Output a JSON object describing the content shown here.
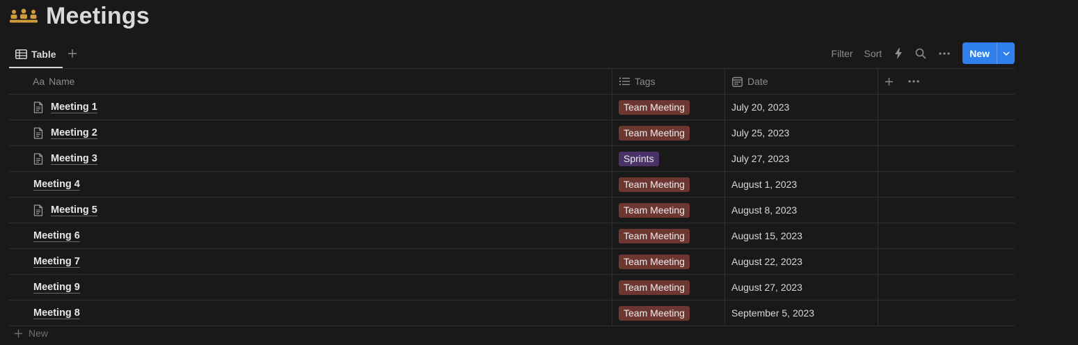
{
  "page": {
    "title": "Meetings",
    "icon": "meeting-people-icon"
  },
  "toolbar": {
    "view_tab_label": "Table",
    "filter_label": "Filter",
    "sort_label": "Sort",
    "new_label": "New"
  },
  "columns": {
    "name_prefix": "Aa",
    "name": "Name",
    "tags": "Tags",
    "date": "Date"
  },
  "rows": [
    {
      "name": "Meeting 1",
      "has_doc_icon": true,
      "tag": "Team Meeting",
      "tag_color": "#6e3630",
      "date": "July 20, 2023"
    },
    {
      "name": "Meeting 2",
      "has_doc_icon": true,
      "tag": "Team Meeting",
      "tag_color": "#6e3630",
      "date": "July 25, 2023"
    },
    {
      "name": "Meeting 3",
      "has_doc_icon": true,
      "tag": "Sprints",
      "tag_color": "#4a3268",
      "date": "July 27, 2023"
    },
    {
      "name": "Meeting 4",
      "has_doc_icon": false,
      "tag": "Team Meeting",
      "tag_color": "#6e3630",
      "date": "August 1, 2023"
    },
    {
      "name": "Meeting 5",
      "has_doc_icon": true,
      "tag": "Team Meeting",
      "tag_color": "#6e3630",
      "date": "August 8, 2023"
    },
    {
      "name": "Meeting 6",
      "has_doc_icon": false,
      "tag": "Team Meeting",
      "tag_color": "#6e3630",
      "date": "August 15, 2023"
    },
    {
      "name": "Meeting 7",
      "has_doc_icon": false,
      "tag": "Team Meeting",
      "tag_color": "#6e3630",
      "date": "August 22, 2023"
    },
    {
      "name": "Meeting 9",
      "has_doc_icon": false,
      "tag": "Team Meeting",
      "tag_color": "#6e3630",
      "date": "August 27, 2023"
    },
    {
      "name": "Meeting 8",
      "has_doc_icon": false,
      "tag": "Team Meeting",
      "tag_color": "#6e3630",
      "date": "September 5, 2023"
    }
  ],
  "footer": {
    "new_row_label": "New"
  },
  "colors": {
    "background": "#191919",
    "accent": "#2f80ed",
    "title_icon": "#d19a3b"
  }
}
